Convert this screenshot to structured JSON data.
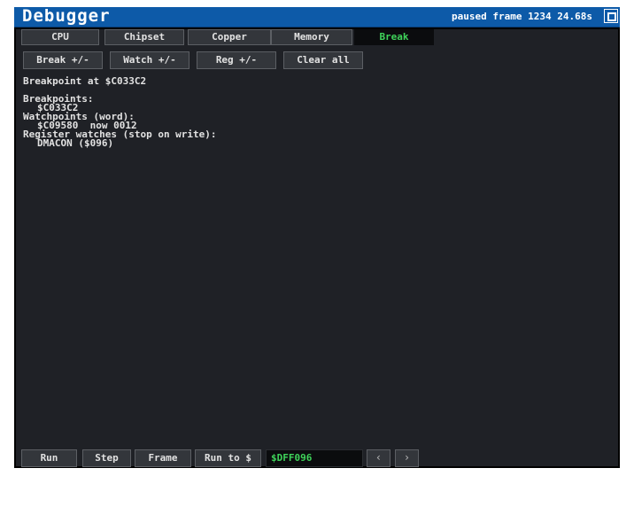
{
  "window": {
    "title": "Debugger",
    "status": "paused frame 1234 24.68s"
  },
  "tabs": [
    {
      "label": "CPU",
      "active": false
    },
    {
      "label": "Chipset",
      "active": false
    },
    {
      "label": "Copper",
      "active": false
    },
    {
      "label": "Memory",
      "active": false
    },
    {
      "label": "Break",
      "active": true
    }
  ],
  "toolbar": {
    "break_toggle": "Break +/-",
    "watch_toggle": "Watch +/-",
    "reg_toggle": "Reg +/-",
    "clear_all": "Clear all"
  },
  "content": {
    "header": "Breakpoint at $C033C2",
    "breakpoints_heading": "Breakpoints:",
    "breakpoints": [
      "$C033C2"
    ],
    "watchpoints_heading": "Watchpoints (word):",
    "watchpoints": [
      "$C09580  now 0012"
    ],
    "register_watches_heading": "Register watches (stop on write):",
    "register_watches": [
      "DMACON ($096)"
    ]
  },
  "bottom_bar": {
    "run": "Run",
    "step": "Step",
    "frame": "Frame",
    "run_to": "Run to $",
    "address_value": "$DFF096"
  },
  "icons": {
    "prev": "chevron-left-icon",
    "next": "chevron-right-icon",
    "close": "window-square-icon"
  },
  "colors": {
    "titlebar": "#0d5aa8",
    "panel": "#1f2126",
    "accent_green": "#3fd35a",
    "text": "#e2e2e2"
  }
}
